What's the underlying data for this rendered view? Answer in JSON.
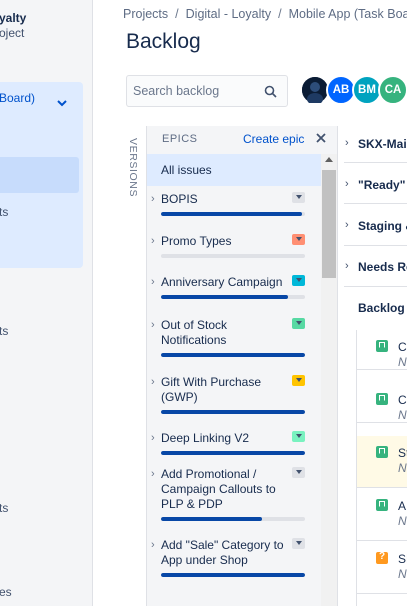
{
  "sidebar": {
    "project_name": "yalty",
    "project_type": "oject",
    "board_selector": "Board)",
    "items": [
      {
        "label": "ts"
      },
      {
        "label": "ts"
      },
      {
        "label": "ts"
      },
      {
        "label": "es"
      }
    ]
  },
  "breadcrumb": [
    "Projects",
    "Digital - Loyalty",
    "Mobile App (Task Board)"
  ],
  "page_title": "Backlog",
  "search": {
    "placeholder": "Search backlog",
    "value": ""
  },
  "avatars": [
    {
      "initials": "",
      "color": "#091e42",
      "kind": "photo"
    },
    {
      "initials": "AB",
      "color": "#0065ff"
    },
    {
      "initials": "BM",
      "color": "#00a3bf"
    },
    {
      "initials": "CA",
      "color": "#36b37e"
    }
  ],
  "versions_label": "VERSIONS",
  "epics_panel": {
    "title": "EPICS",
    "create_label": "Create epic",
    "all_issues_label": "All issues",
    "epics": [
      {
        "name": "BOPIS",
        "color": "#dfe1e6",
        "progress": 0.98
      },
      {
        "name": "Promo Types",
        "color": "#ff8f73",
        "progress": 0.0
      },
      {
        "name": "Anniversary Campaign",
        "color": "#00b8d9",
        "progress": 0.88
      },
      {
        "name": "Out of Stock Notifications",
        "color": "#57d9a3",
        "progress": 1.0
      },
      {
        "name": "Gift With Purchase (GWP)",
        "color": "#ffc400",
        "progress": 1.0
      },
      {
        "name": "Deep Linking V2",
        "color": "#79f2c0",
        "progress": 1.0
      },
      {
        "name": "Add Promotional / Campaign Callouts to PLP & PDP",
        "color": "#dfe1e6",
        "progress": 0.7
      },
      {
        "name": "Add \"Sale\" Category to App under Shop",
        "color": "#dfe1e6",
        "progress": 1.0
      }
    ]
  },
  "sprints": [
    {
      "name": "SKX-Main"
    },
    {
      "name": "\"Ready\""
    },
    {
      "name": "Staging &"
    },
    {
      "name": "Needs Re"
    }
  ],
  "backlog_label": "Backlog",
  "issues": [
    {
      "summary": "C",
      "sub": "N",
      "type": "story",
      "type_color": "#36b37e",
      "flagged": false
    },
    {
      "summary": "C",
      "sub": "N",
      "type": "story",
      "type_color": "#36b37e",
      "flagged": false
    },
    {
      "summary": "St",
      "sub": "N",
      "type": "story",
      "type_color": "#36b37e",
      "flagged": true
    },
    {
      "summary": "A",
      "sub": "N",
      "type": "story",
      "type_color": "#36b37e",
      "flagged": false
    },
    {
      "summary": "SF",
      "sub": "N",
      "type": "question",
      "type_color": "#ff991f",
      "flagged": false
    }
  ]
}
